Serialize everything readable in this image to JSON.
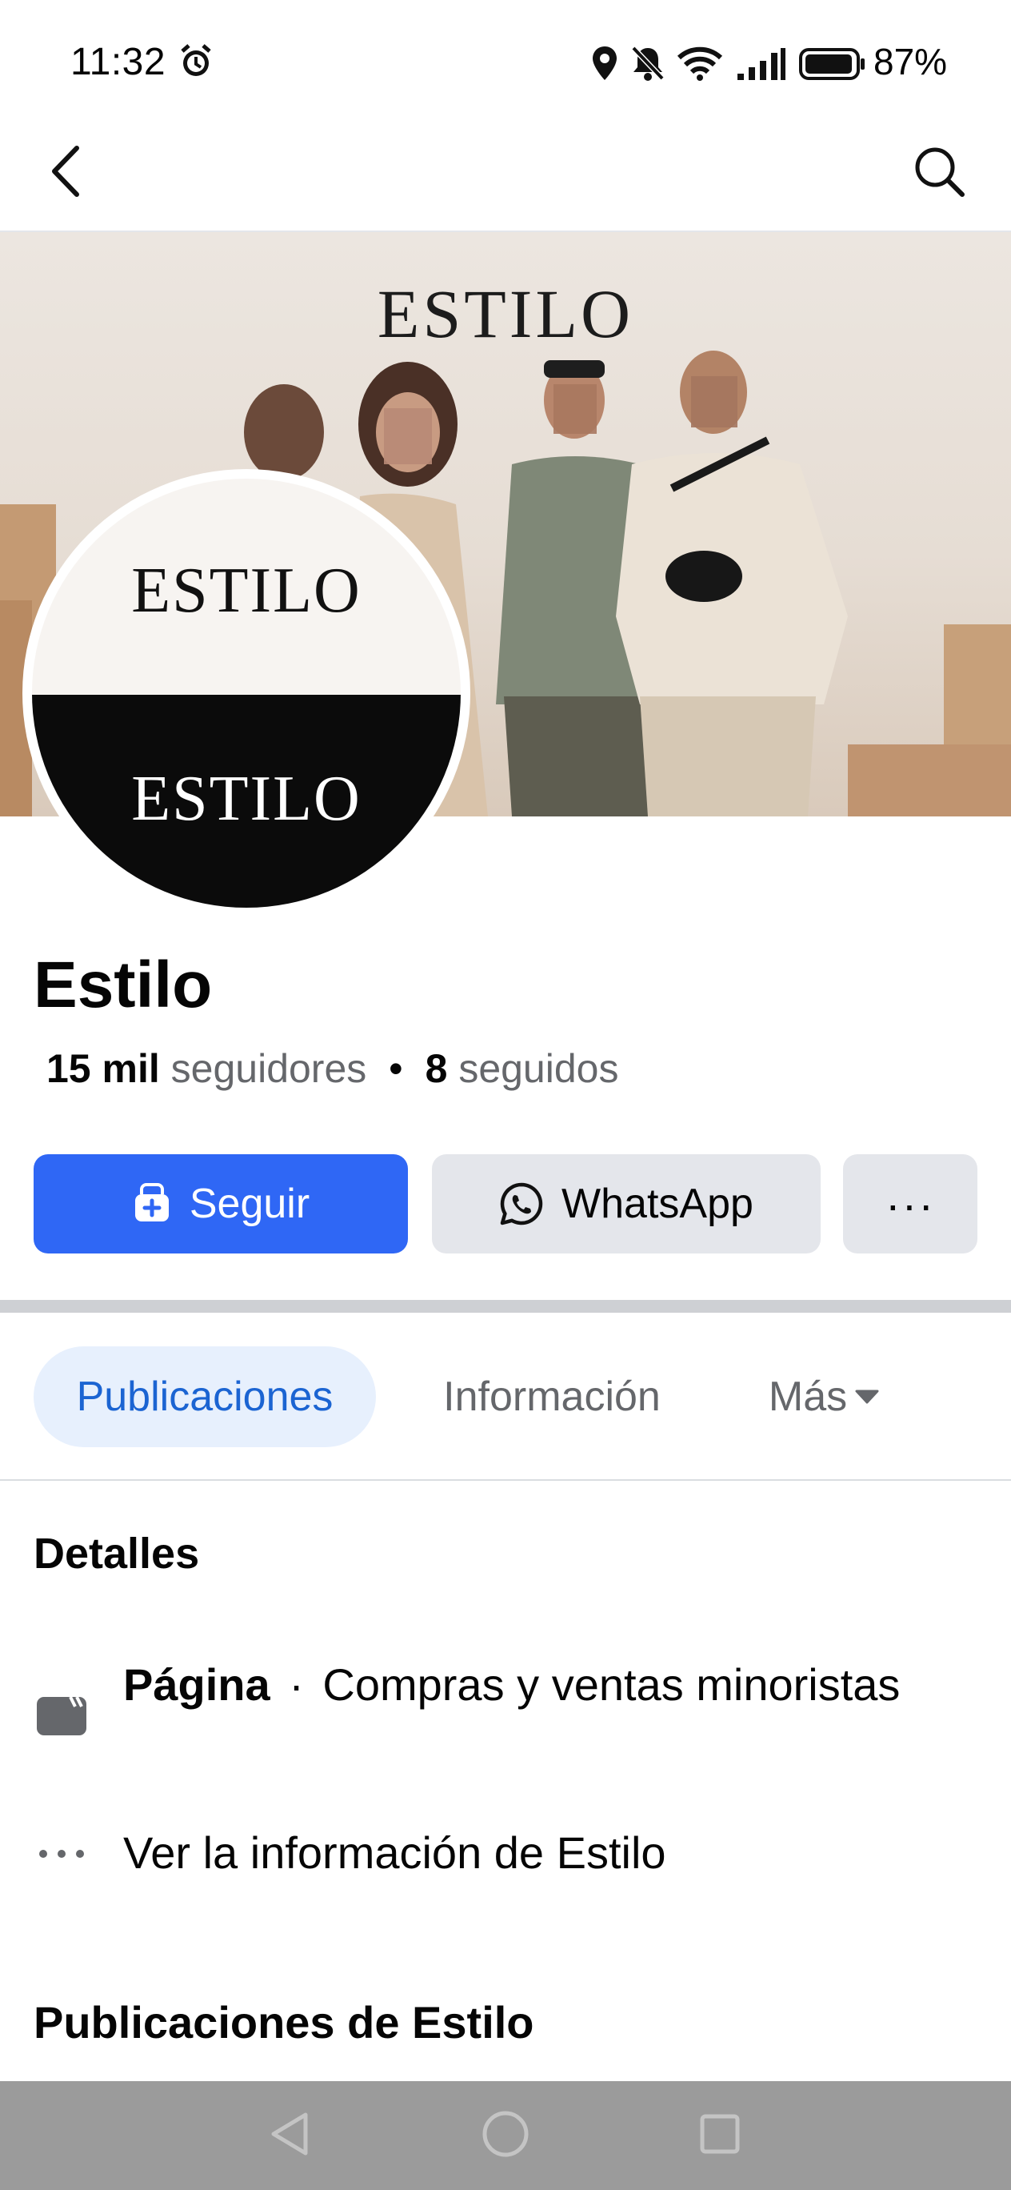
{
  "status_bar": {
    "time": "11:32",
    "battery_percent": "87%",
    "icons": [
      "alarm-icon",
      "location-icon",
      "bell-off-icon",
      "wifi-icon",
      "signal-icon",
      "battery-icon"
    ]
  },
  "top_nav": {
    "icons": [
      "back-arrow-icon",
      "search-icon"
    ]
  },
  "cover": {
    "brand_text": "ESTILO"
  },
  "profile_picture": {
    "top_text": "ESTILO",
    "bottom_text": "ESTILO"
  },
  "page": {
    "name": "Estilo",
    "followers_count": "15 mil",
    "followers_label": "seguidores",
    "separator": "•",
    "following_count": "8",
    "following_label": "seguidos"
  },
  "actions": {
    "follow_label": "Seguir",
    "whatsapp_label": "WhatsApp",
    "more_label": "···"
  },
  "tabs": [
    {
      "label": "Publicaciones",
      "active": true
    },
    {
      "label": "Información",
      "active": false
    },
    {
      "label": "Más",
      "active": false
    }
  ],
  "details": {
    "heading": "Detalles",
    "category_type": "Página",
    "category_separator": "·",
    "category_value": "Compras y ventas minoristas",
    "info_link": "Ver la información de Estilo"
  },
  "posts": {
    "heading": "Publicaciones de Estilo"
  },
  "colors": {
    "accent": "#2f67f5",
    "tab_active_bg": "#e7f0fd",
    "tab_active_text": "#1b64d2",
    "secondary_button": "#e4e6eb",
    "system_nav": "#9b9b9b"
  }
}
